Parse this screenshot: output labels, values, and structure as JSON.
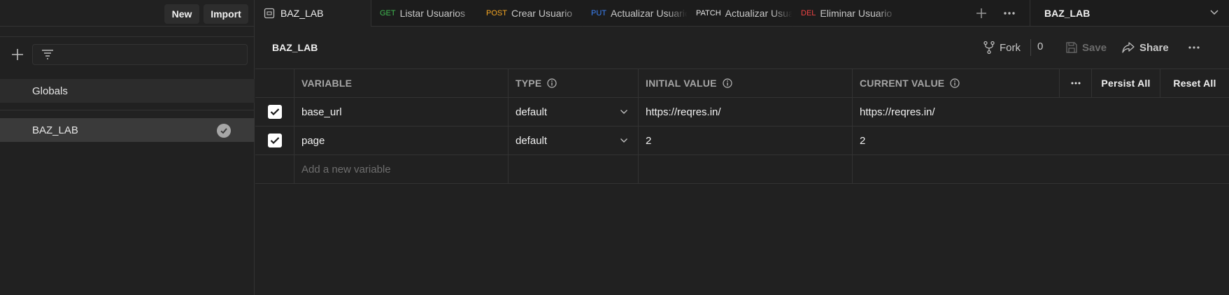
{
  "sidebar": {
    "new_label": "New",
    "import_label": "Import",
    "filter_placeholder": "",
    "environments": [
      {
        "label": "Globals",
        "active": false
      },
      {
        "label": "BAZ_LAB",
        "active": true
      }
    ]
  },
  "tabs": [
    {
      "method": "",
      "label": "BAZ_LAB",
      "icon": "environment-icon"
    },
    {
      "method": "GET",
      "label": "Listar Usuarios",
      "color": "#3fb950"
    },
    {
      "method": "POST",
      "label": "Crear Usuario",
      "color": "#f5a623"
    },
    {
      "method": "PUT",
      "label": "Actualizar Usuario",
      "color": "#3b82f6"
    },
    {
      "method": "PATCH",
      "label": "Actualizar Usuario",
      "color": "#e6e6e6"
    },
    {
      "method": "DEL",
      "label": "Eliminar Usuario",
      "color": "#ef4444"
    }
  ],
  "environment_selector": {
    "selected": "BAZ_LAB"
  },
  "header": {
    "title": "BAZ_LAB",
    "fork_label": "Fork",
    "fork_count": "0",
    "save_label": "Save",
    "share_label": "Share"
  },
  "table": {
    "columns": {
      "variable": "VARIABLE",
      "type": "TYPE",
      "initial_value": "INITIAL VALUE",
      "current_value": "CURRENT VALUE",
      "persist_all": "Persist All",
      "reset_all": "Reset All"
    },
    "rows": [
      {
        "enabled": true,
        "variable": "base_url",
        "type": "default",
        "initial_value": "https://reqres.in/",
        "current_value": "https://reqres.in/"
      },
      {
        "enabled": true,
        "variable": "page",
        "type": "default",
        "initial_value": "2",
        "current_value": "2"
      }
    ],
    "add_placeholder": "Add a new variable"
  },
  "colors": {
    "background": "#212121",
    "tabbar": "#1c1c1c",
    "border": "#333333",
    "selected_item": "#3a3a3a"
  }
}
